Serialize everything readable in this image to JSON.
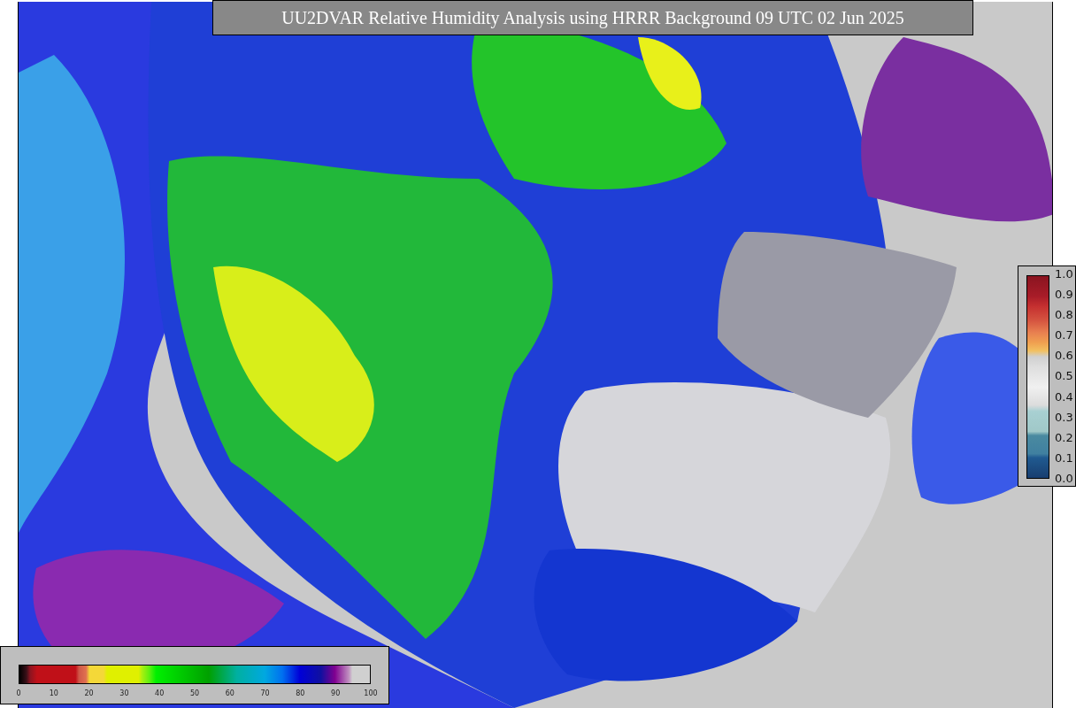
{
  "title": "UU2DVAR Relative Humidity Analysis using HRRR Background 09 UTC 02 Jun 2025",
  "vertical_colorbar": {
    "ticks": [
      "1.0",
      "0.9",
      "0.8",
      "0.7",
      "0.6",
      "0.5",
      "0.4",
      "0.3",
      "0.2",
      "0.1",
      "0.0"
    ]
  },
  "horizontal_colorbar": {
    "ticks": [
      "0",
      "10",
      "20",
      "30",
      "40",
      "50",
      "60",
      "70",
      "80",
      "90",
      "100"
    ]
  }
}
